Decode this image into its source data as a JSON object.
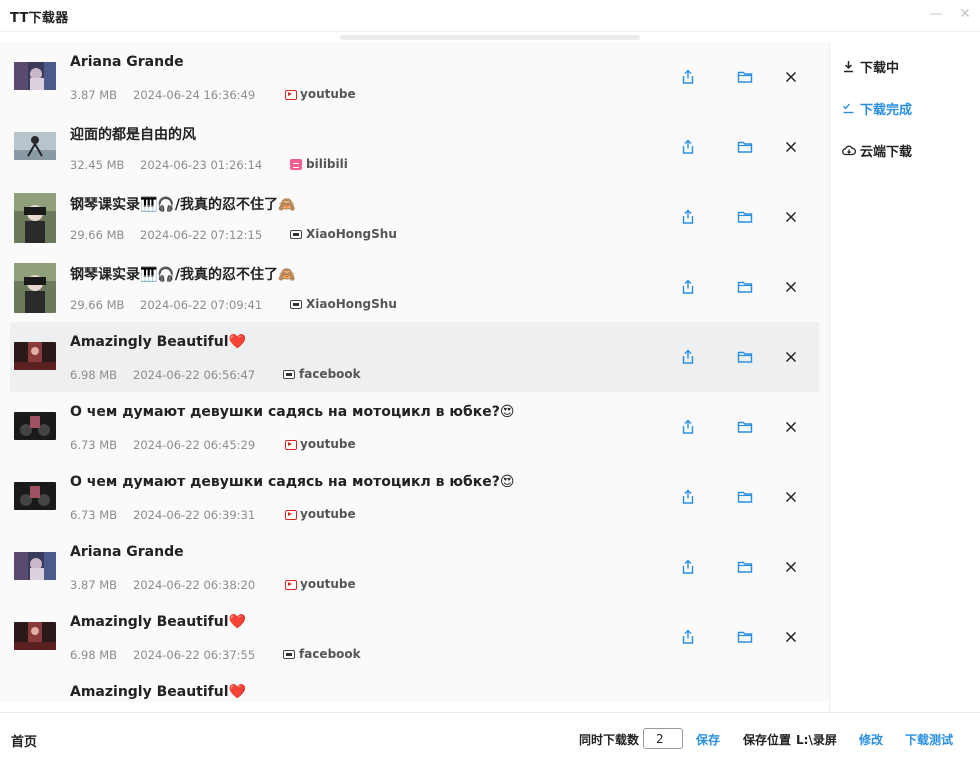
{
  "window": {
    "title": "TT下载器",
    "minimize_glyph": "—",
    "close_glyph": "✕"
  },
  "colors": {
    "accent": "#2b8fe0",
    "highlight_row": "#eeeff1",
    "meta_text": "#8c8c8c"
  },
  "sidebar": {
    "items": [
      {
        "label": "下载中",
        "icon": "download-icon",
        "active": false
      },
      {
        "label": "下载完成",
        "icon": "check-list-icon",
        "active": true
      },
      {
        "label": "云端下载",
        "icon": "cloud-download-icon",
        "active": false
      }
    ]
  },
  "downloads": [
    {
      "title": "Ariana Grande",
      "size": "3.87 MB",
      "time": "2024-06-24 16:36:49",
      "source": "youtube"
    },
    {
      "title": "迎面的都是自由的风",
      "size": "32.45 MB",
      "time": "2024-06-23 01:26:14",
      "source": "bilibili"
    },
    {
      "title": "钢琴课实录🎹🎧/我真的忍不住了🙈",
      "size": "29.66 MB",
      "time": "2024-06-22 07:12:15",
      "source": "XiaoHongShu"
    },
    {
      "title": "钢琴课实录🎹🎧/我真的忍不住了🙈",
      "size": "29.66 MB",
      "time": "2024-06-22 07:09:41",
      "source": "XiaoHongShu"
    },
    {
      "title": "Amazingly Beautiful❤️",
      "size": "6.98 MB",
      "time": "2024-06-22 06:56:47",
      "source": "facebook"
    },
    {
      "title": "О чем думают девушки садясь на мотоцикл в юбке?😍",
      "size": "6.73 MB",
      "time": "2024-06-22 06:45:29",
      "source": "youtube"
    },
    {
      "title": "О чем думают девушки садясь на мотоцикл в юбке?😍",
      "size": "6.73 MB",
      "time": "2024-06-22 06:39:31",
      "source": "youtube"
    },
    {
      "title": "Ariana Grande",
      "size": "3.87 MB",
      "time": "2024-06-22 06:38:20",
      "source": "youtube"
    },
    {
      "title": "Amazingly Beautiful❤️",
      "size": "6.98 MB",
      "time": "2024-06-22 06:37:55",
      "source": "facebook"
    },
    {
      "title": "Amazingly Beautiful❤️",
      "size": "",
      "time": "",
      "source": ""
    }
  ],
  "bottom": {
    "home": "首页",
    "concurrent_label": "同时下载数",
    "concurrent_value": "2",
    "save": "保存",
    "save_path_label": "保存位置",
    "save_path": "L:\\录屏",
    "modify": "修改",
    "test": "下载测试"
  }
}
